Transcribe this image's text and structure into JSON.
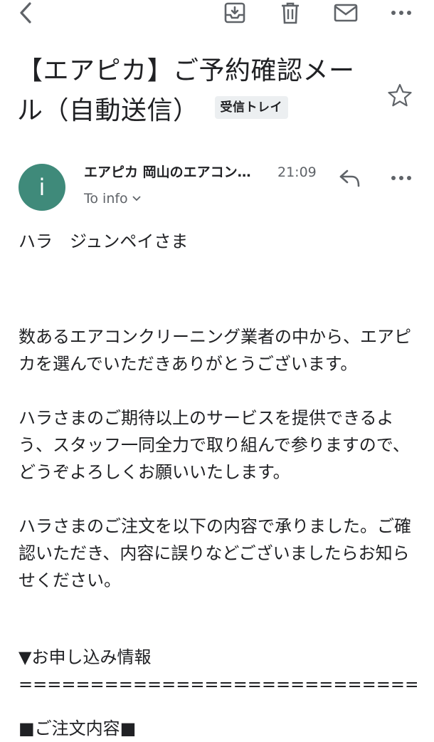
{
  "subject": {
    "title": "【エアピカ】ご予約確認メール（自動送信）",
    "label": "受信トレイ"
  },
  "message": {
    "avatar_letter": "i",
    "sender": "エアピカ 岡山のエアコン…",
    "time": "21:09",
    "to": "To info"
  },
  "body": {
    "greeting": "ハラ　ジュンペイさま",
    "p1": "数あるエアコンクリーニング業者の中から、エアピカを選んでいただきありがとうございます。",
    "p2": "ハラさまのご期待以上のサービスを提供できるよう、スタッフ一同全力で取り組んで参りますので、どうぞよろしくお願いいたします。",
    "p3": "ハラさまのご注文を以下の内容で承りました。ご確認いただき、内容に誤りなどございましたらお知らせください。",
    "section_title": "▼お申し込み情報",
    "divider": "================================",
    "order_title": "■ご注文内容■"
  },
  "icons": {
    "back": "back-arrow-icon",
    "archive": "archive-icon",
    "delete": "trash-icon",
    "mail": "mail-icon",
    "more": "more-horizontal-icon",
    "star": "star-outline-icon",
    "reply": "reply-icon",
    "chevron": "chevron-down-icon"
  },
  "colors": {
    "avatar": "#3f8a7a",
    "icon": "#5f6368",
    "label_bg": "#eceff1"
  }
}
